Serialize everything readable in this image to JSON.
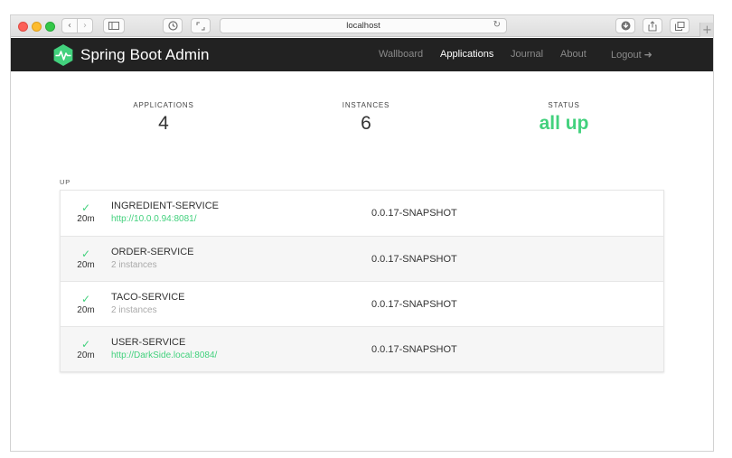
{
  "browser": {
    "url": "localhost",
    "icons": {
      "back": "chevron-left-icon",
      "forward": "chevron-right-icon",
      "sidebar": "sidebar-icon",
      "history": "history-icon",
      "expand": "expand-icon",
      "reload": "reload-icon",
      "download": "download-icon",
      "share": "share-icon",
      "tabs": "tabs-icon",
      "new_tab": "plus-icon"
    }
  },
  "navbar": {
    "brand": "Spring Boot Admin",
    "links": [
      {
        "label": "Wallboard",
        "active": false
      },
      {
        "label": "Applications",
        "active": true
      },
      {
        "label": "Journal",
        "active": false
      },
      {
        "label": "About",
        "active": false
      }
    ],
    "logout_label": "Logout",
    "colors": {
      "background": "#222222",
      "logo": "#42d17d"
    }
  },
  "stats": {
    "applications": {
      "label": "APPLICATIONS",
      "value": "4"
    },
    "instances": {
      "label": "INSTANCES",
      "value": "6"
    },
    "status": {
      "label": "STATUS",
      "value": "all up"
    }
  },
  "group": {
    "label": "UP",
    "apps": [
      {
        "name": "INGREDIENT-SERVICE",
        "sub": "http://10.0.0.94:8081/",
        "uptime": "20m",
        "version": "0.0.17-SNAPSHOT"
      },
      {
        "name": "ORDER-SERVICE",
        "sub": "2 instances",
        "uptime": "20m",
        "version": "0.0.17-SNAPSHOT"
      },
      {
        "name": "TACO-SERVICE",
        "sub": "2 instances",
        "uptime": "20m",
        "version": "0.0.17-SNAPSHOT"
      },
      {
        "name": "USER-SERVICE",
        "sub": "http://DarkSide.local:8084/",
        "uptime": "20m",
        "version": "0.0.17-SNAPSHOT"
      }
    ]
  },
  "colors": {
    "accent": "#42d17d"
  }
}
